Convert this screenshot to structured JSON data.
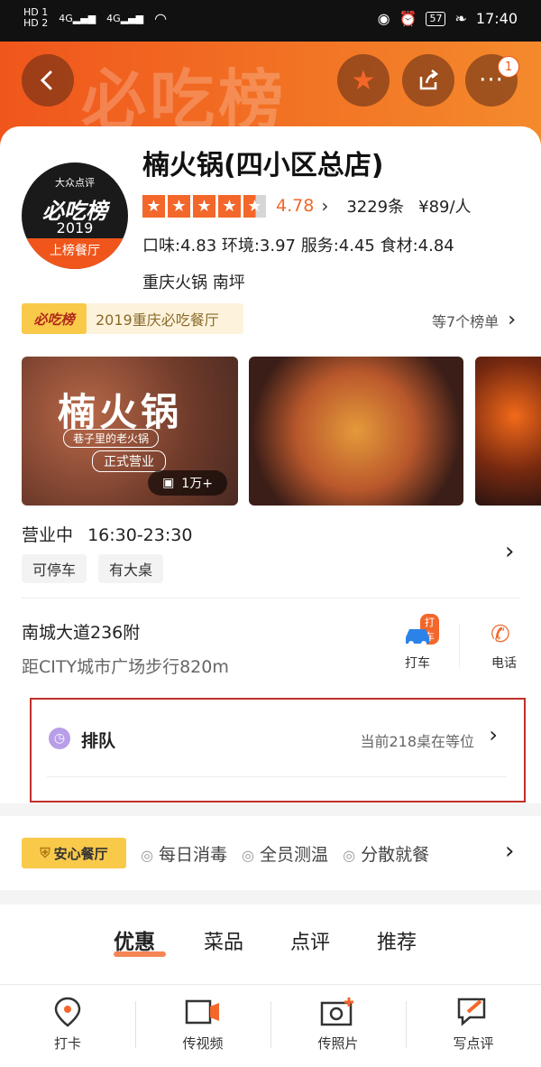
{
  "status_bar": {
    "sim1": "HD 1",
    "sim2": "HD 2",
    "net1": "4G",
    "net2": "4G",
    "battery": "57",
    "time": "17:40"
  },
  "header": {
    "watermark": "必吃榜",
    "more_badge": "1"
  },
  "restaurant": {
    "logo": {
      "brand": "大众点评",
      "title": "必吃榜",
      "year": "2019",
      "ribbon": "上榜餐厅"
    },
    "name": "楠火锅(四小区总店)",
    "rating": 4.78,
    "rating_text": "4.78",
    "review_count": "3229条",
    "price": "¥89/人",
    "sub_scores": "口味:4.83  环境:3.97  服务:4.45  食材:4.84",
    "category": "重庆火锅  南坪"
  },
  "ranking": {
    "logo": "必吃榜",
    "text": "2019重庆必吃餐厅",
    "more": "等7个榜单"
  },
  "photos": {
    "overlay_title": "楠火锅",
    "overlay_sub": "巷子里的老火锅",
    "overlay_open": "正式营业",
    "count": "1万+"
  },
  "hours": {
    "status": "营业中",
    "time": "16:30-23:30",
    "tags": [
      "可停车",
      "有大桌"
    ]
  },
  "address": {
    "street": "南城大道236附",
    "distance": "距CITY城市广场步行820m",
    "taxi_badge": "打车",
    "taxi_label": "打车",
    "phone_label": "电话"
  },
  "queue": {
    "label": "排队",
    "status": "当前218桌在等位"
  },
  "safety": {
    "badge": "安心餐厅",
    "items": [
      "每日消毒",
      "全员测温",
      "分散就餐"
    ]
  },
  "tabs": [
    "优惠",
    "菜品",
    "点评",
    "推荐"
  ],
  "bottom_nav": [
    "打卡",
    "传视频",
    "传照片",
    "写点评"
  ],
  "colors": {
    "accent": "#f3672a",
    "queue_highlight": "#c0302a"
  }
}
